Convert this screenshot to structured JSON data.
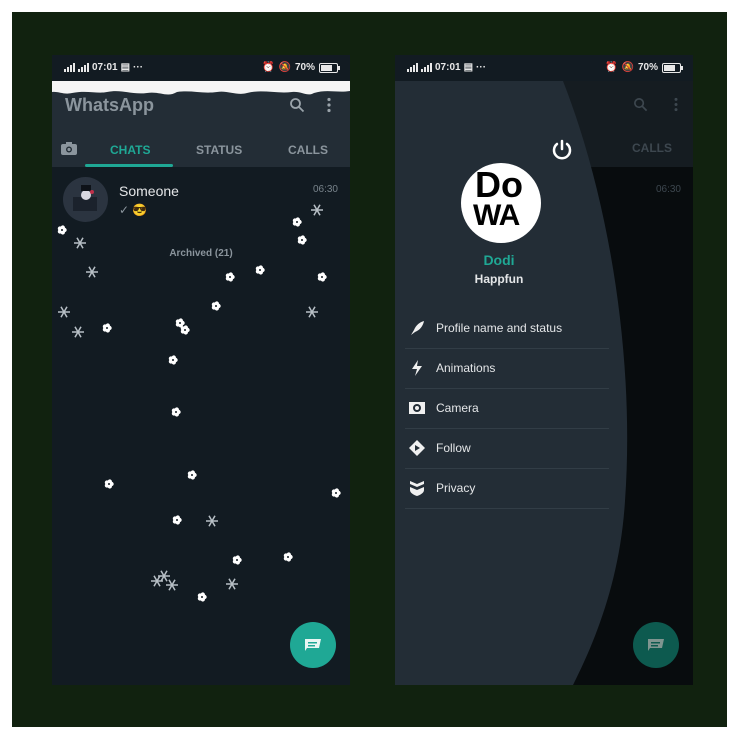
{
  "colors": {
    "frame": "#11220f",
    "background": "#121b22",
    "appbar": "#232d36",
    "accent": "#1fa895",
    "text_primary": "#e4e6e8",
    "text_secondary": "#8b959d"
  },
  "left_screen": {
    "status_bar": {
      "network": "4G",
      "time": "07:01",
      "extra": "···",
      "battery": "70%",
      "battery_level": 0.7
    },
    "app_title": "WhatsApp",
    "icons": [
      "search-icon",
      "more-vert-icon",
      "camera-icon"
    ],
    "tabs": [
      {
        "label": "CHATS",
        "active": true
      },
      {
        "label": "STATUS",
        "active": false
      },
      {
        "label": "CALLS",
        "active": false
      }
    ],
    "chats": [
      {
        "name": "Someone",
        "time": "06:30",
        "preview": "✓ 😎"
      }
    ],
    "archived_label": "Archived (21)",
    "fab_icon": "new-chat-icon"
  },
  "right_screen": {
    "status_bar": {
      "network": "4G",
      "time": "07:01",
      "extra": "···",
      "battery": "70%",
      "battery_level": 0.7
    },
    "background_tab": "CALLS",
    "background_chat_time": "06:30",
    "drawer": {
      "logo_line1": "Do",
      "logo_line2": "WA",
      "name": "Dodi",
      "subtitle": "Happfun",
      "menu": [
        {
          "label": "Profile name and status",
          "icon": "feather-icon"
        },
        {
          "label": "Animations",
          "icon": "bolt-icon"
        },
        {
          "label": "Camera",
          "icon": "camera-icon"
        },
        {
          "label": "Follow",
          "icon": "follow-icon"
        },
        {
          "label": "Privacy",
          "icon": "shield-icon"
        }
      ]
    }
  }
}
